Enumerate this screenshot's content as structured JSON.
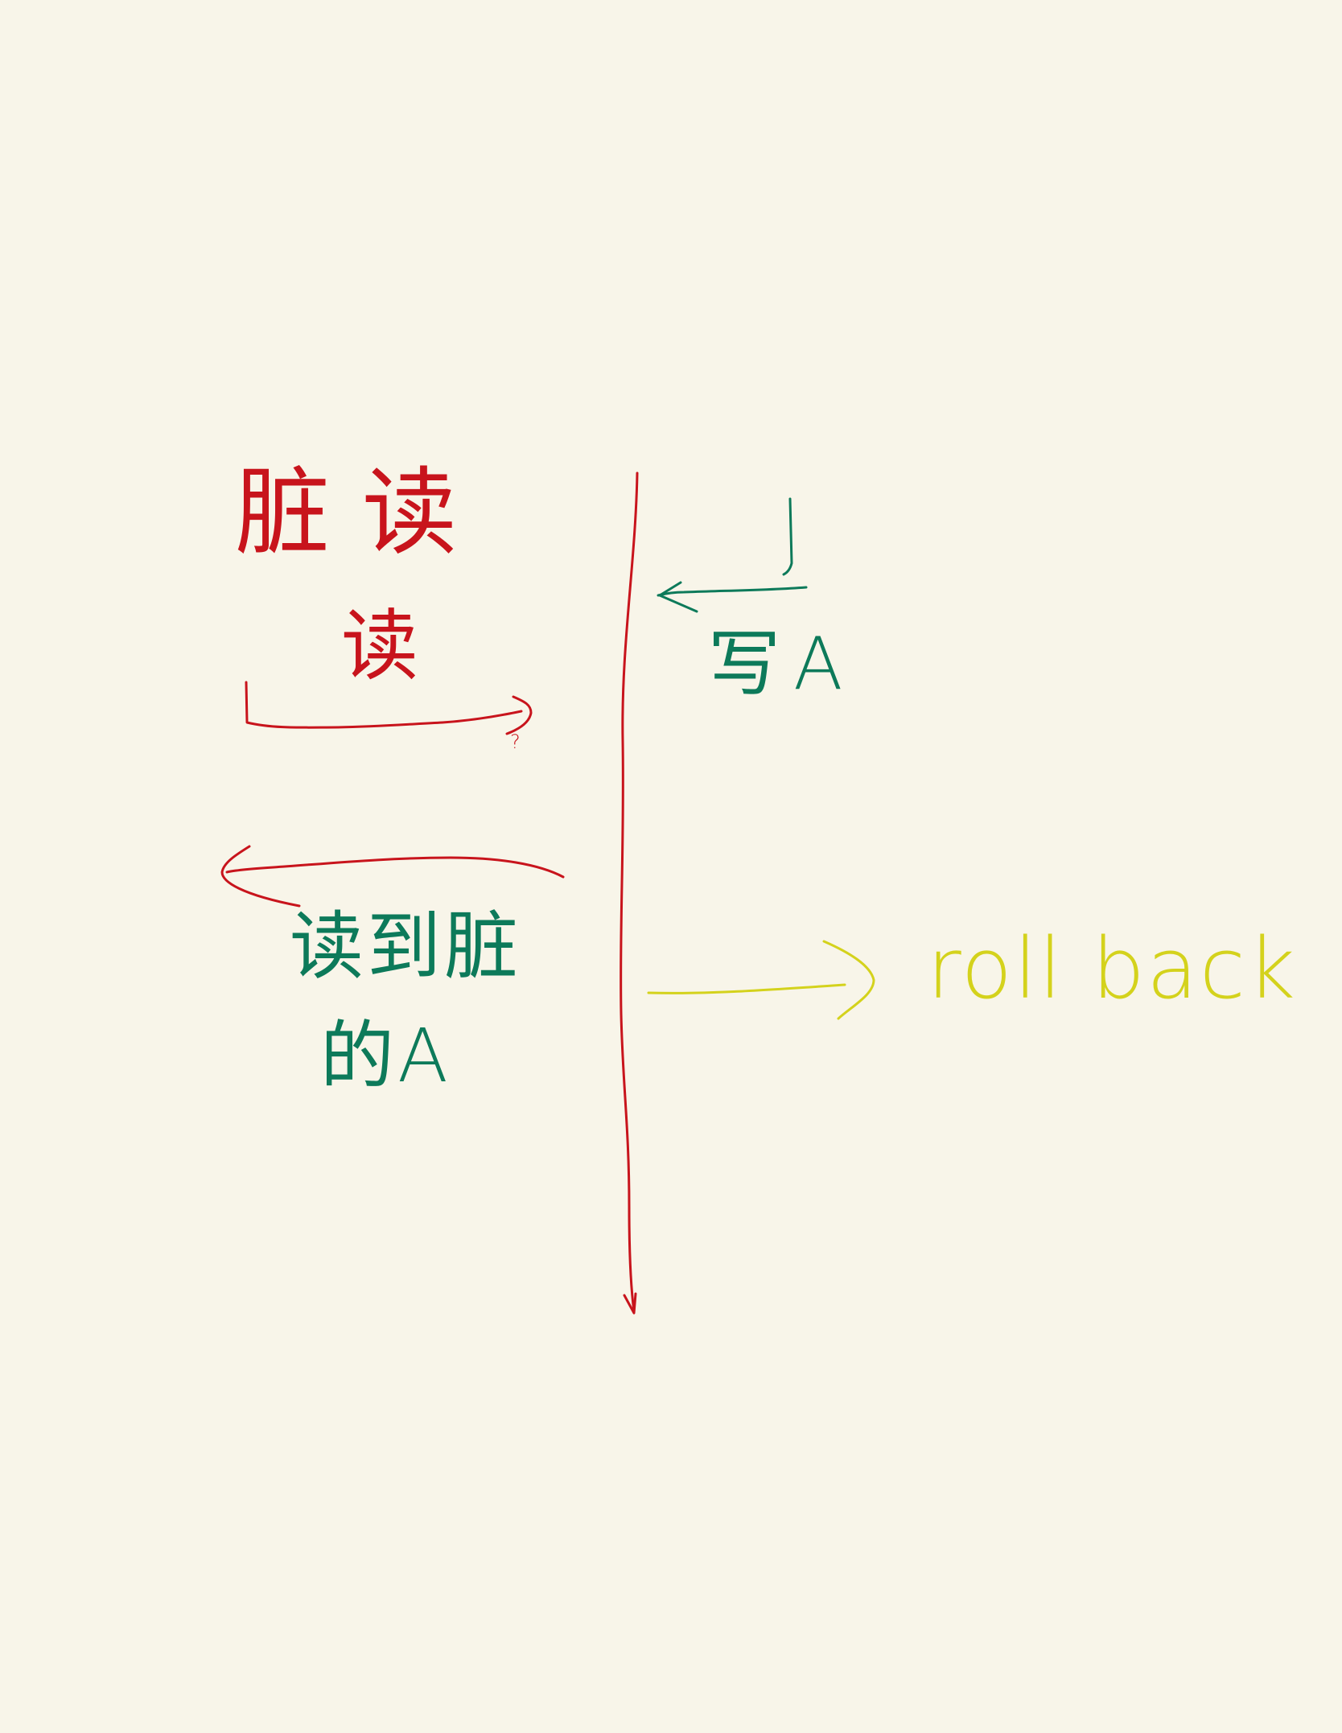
{
  "colors": {
    "background": "#f8f5e9",
    "transaction_a": "#c8141c",
    "transaction_b": "#0d7a5a",
    "rollback": "#d4d21c"
  },
  "labels": {
    "title": "脏读",
    "read": "读",
    "question_mark": "?",
    "write_a": "写A",
    "read_dirty_line1": "读到脏",
    "read_dirty_line2": "的A",
    "rollback": "roll back"
  }
}
